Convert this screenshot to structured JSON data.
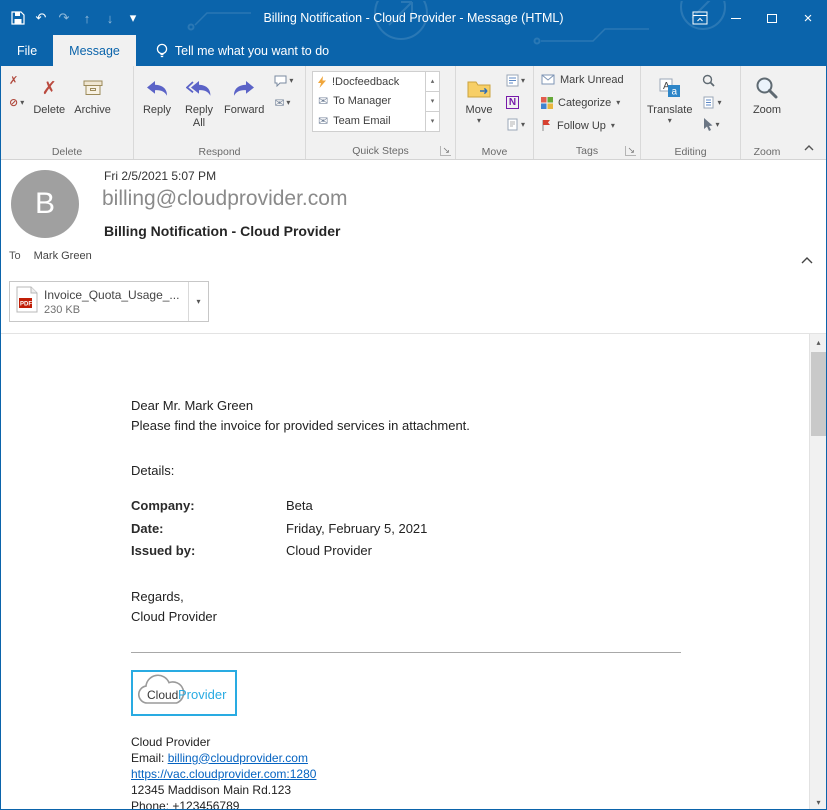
{
  "titlebar": {
    "title": "Billing Notification - Cloud Provider -  Message (HTML)"
  },
  "tabs": {
    "file": "File",
    "message": "Message",
    "tellme": "Tell me what you want to do"
  },
  "ribbon": {
    "groups": {
      "delete": "Delete",
      "respond": "Respond",
      "quicksteps": "Quick Steps",
      "move": "Move",
      "tags": "Tags",
      "editing": "Editing",
      "zoom": "Zoom"
    },
    "buttons": {
      "delete": "Delete",
      "archive": "Archive",
      "reply": "Reply",
      "reply_all": "Reply All",
      "forward": "Forward",
      "move": "Move",
      "mark_unread": "Mark Unread",
      "categorize": "Categorize",
      "follow_up": "Follow Up",
      "translate": "Translate",
      "zoom": "Zoom"
    },
    "quick_steps": [
      {
        "label": "!Docfeedback"
      },
      {
        "label": "To Manager"
      },
      {
        "label": "Team Email"
      }
    ]
  },
  "icons": {
    "undo": "↶",
    "redo": "↷",
    "prev": "↑",
    "next": "↓",
    "dropdown": "▾",
    "up_small": "▴",
    "close": "×",
    "ignore": "✗",
    "junk": "⊘",
    "delete": "✗",
    "envelope": "✉",
    "launcher": "↘",
    "ellipsis": "⋯"
  },
  "header": {
    "avatar_initial": "B",
    "date": "Fri 2/5/2021 5:07 PM",
    "sender": "billing@cloudprovider.com",
    "subject": "Billing Notification - Cloud Provider",
    "to_label": "To",
    "to_value": "Mark Green"
  },
  "attachment": {
    "filename": "Invoice_Quota_Usage_...",
    "size": "230 KB",
    "type_label": "PDF"
  },
  "email": {
    "greeting": "Dear Mr. Mark Green",
    "intro": "Please find the invoice for provided services in attachment.",
    "details_label": "Details:",
    "details": [
      {
        "label": "Company:",
        "value": "Beta"
      },
      {
        "label": "Date:",
        "value": "Friday, February 5, 2021"
      },
      {
        "label": "Issued by:",
        "value": "Cloud Provider"
      }
    ],
    "regards": "Regards,",
    "signature": "Cloud Provider",
    "logo": {
      "word1": "Cloud",
      "word2": "Provider"
    },
    "footer": {
      "company": "Cloud Provider",
      "email_label": "Email: ",
      "email_link": "billing@cloudprovider.com",
      "url": "https://vac.cloudprovider.com:1280",
      "address": "12345 Maddison Main Rd.123",
      "phone": "Phone: +123456789"
    }
  },
  "colors": {
    "titlebar_blue": "#0b64ab",
    "link_blue": "#0563c1",
    "logo_cyan": "#29abe2",
    "flag_red": "#d6402f"
  }
}
